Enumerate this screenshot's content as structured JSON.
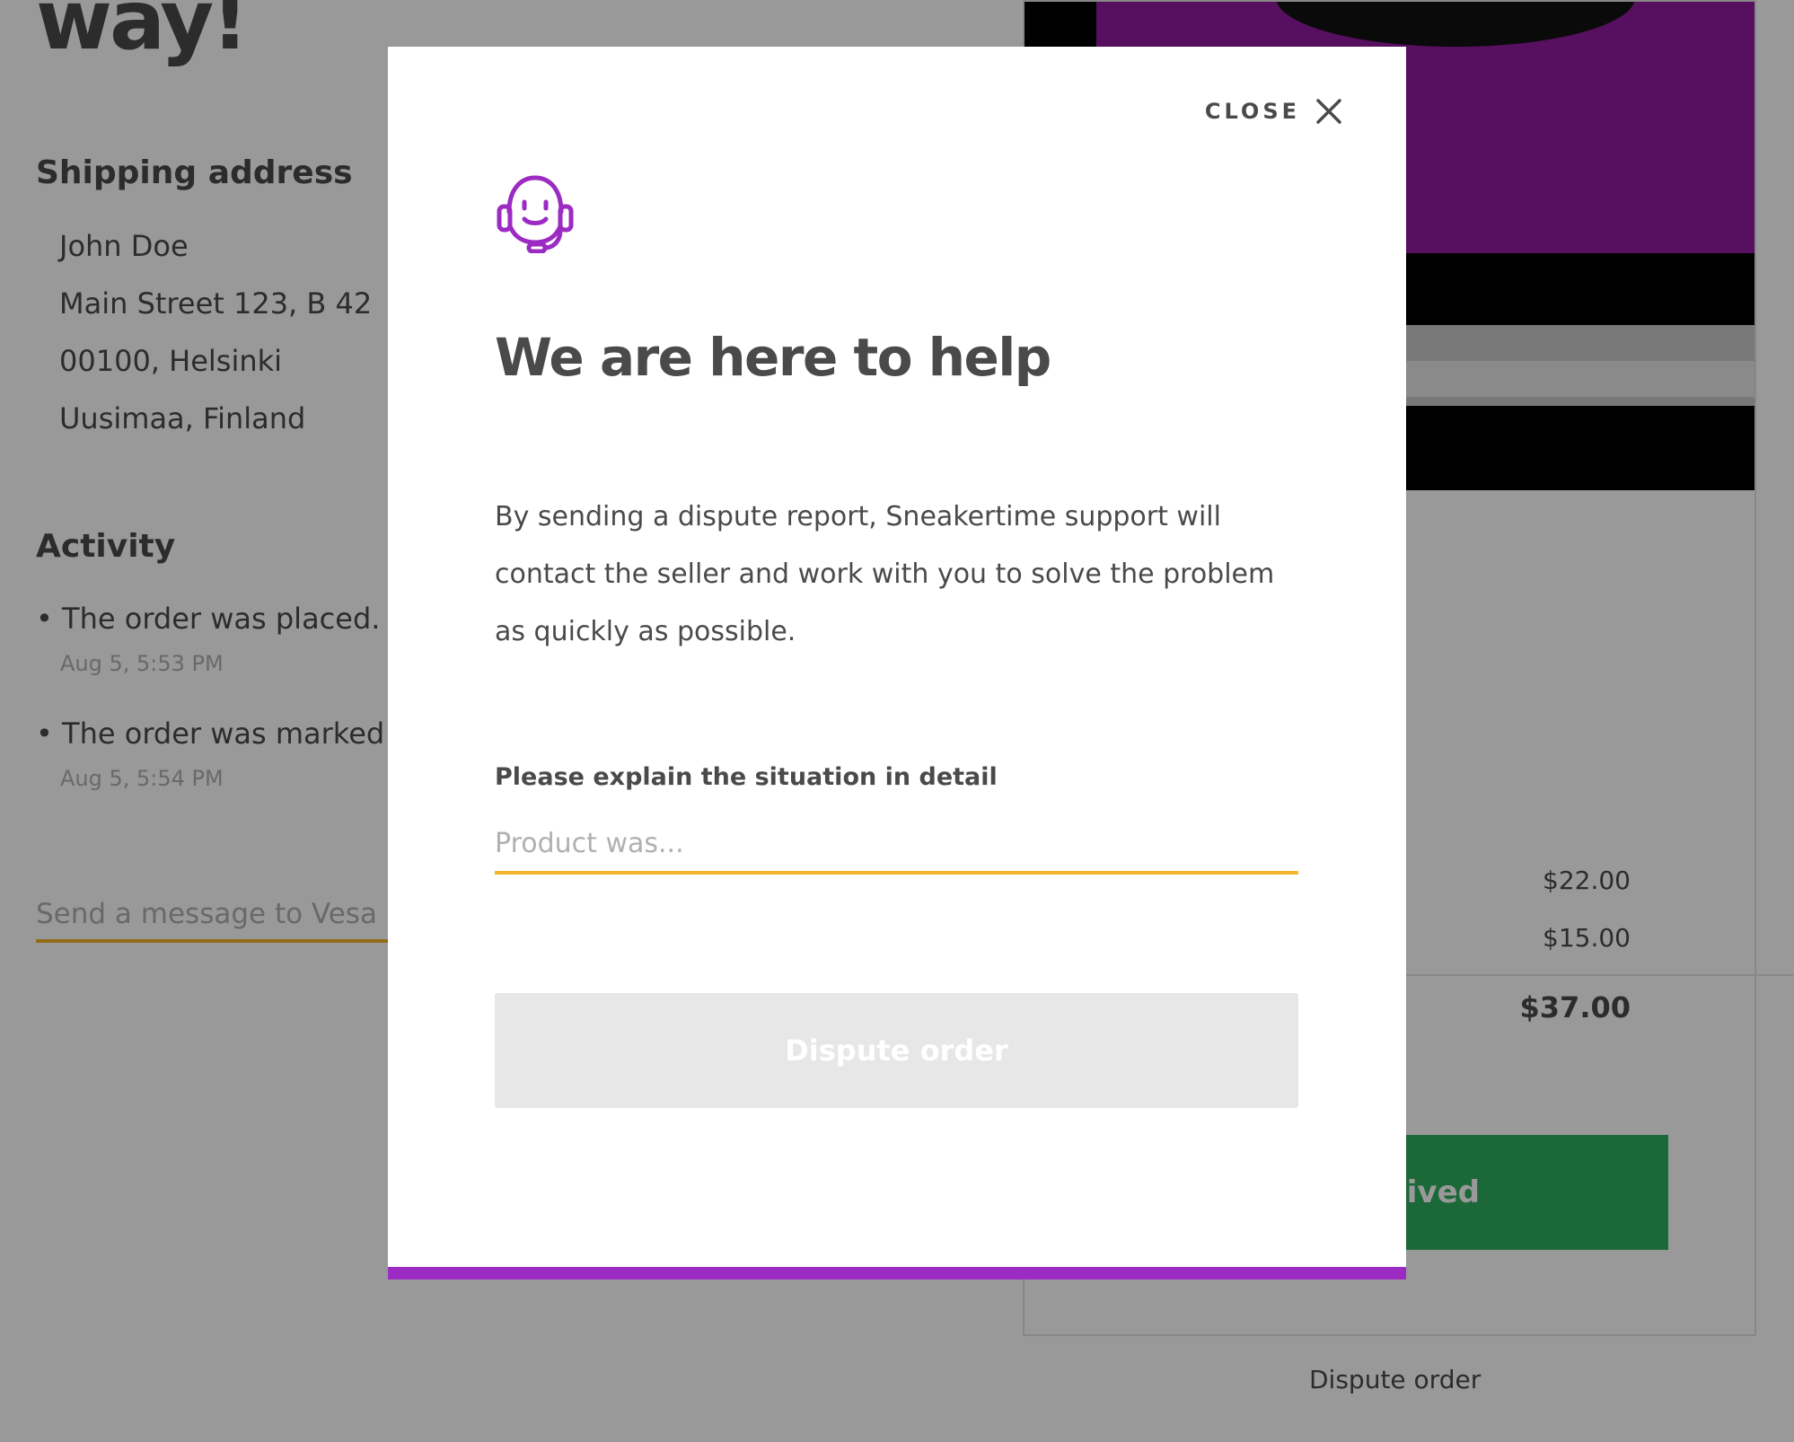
{
  "page": {
    "heading_fragment": "way!",
    "shipping": {
      "title": "Shipping address",
      "lines": [
        "John Doe",
        "Main Street 123, B 42",
        "00100, Helsinki",
        "Uusimaa, Finland"
      ]
    },
    "activity": {
      "title": "Activity",
      "items": [
        {
          "text": "The order was placed.",
          "time": "Aug 5, 5:53 PM"
        },
        {
          "text": "The order was marked",
          "time": "Aug 5, 5:54 PM"
        }
      ]
    },
    "message_placeholder": "Send a message to Vesa L",
    "order_card": {
      "prices": [
        "$22.00",
        "$15.00"
      ],
      "total": "$37.00",
      "received_button_visible_text": "ceived"
    },
    "dispute_link": "Dispute order"
  },
  "modal": {
    "close_label": "CLOSE",
    "title": "We are here to help",
    "description": "By sending a dispute report, Sneakertime support will contact the seller and work with you to solve the problem as quickly as possible.",
    "field_label": "Please explain the situation in detail",
    "field_placeholder": "Product was...",
    "submit_label": "Dispute order"
  },
  "colors": {
    "accent_purple": "#9b2bc3",
    "input_underline": "#f4b52b",
    "primary_green": "#2eaf5e",
    "disabled_button": "#e7e7e7",
    "text": "#4a4a4a",
    "muted": "#b0b0b0"
  },
  "icons": [
    "support-headset-icon",
    "close-icon"
  ]
}
